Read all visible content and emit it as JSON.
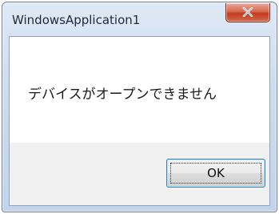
{
  "window": {
    "title": "WindowsApplication1",
    "close_icon": "close-x-icon"
  },
  "dialog": {
    "message": "デバイスがオープンできません",
    "ok_label": "OK"
  },
  "colors": {
    "titlebar": "#cdddef",
    "close_button": "#c23c22",
    "client_background": "#ffffff",
    "footer_background": "#f0f0f0",
    "button_border": "#3c7fb1"
  }
}
